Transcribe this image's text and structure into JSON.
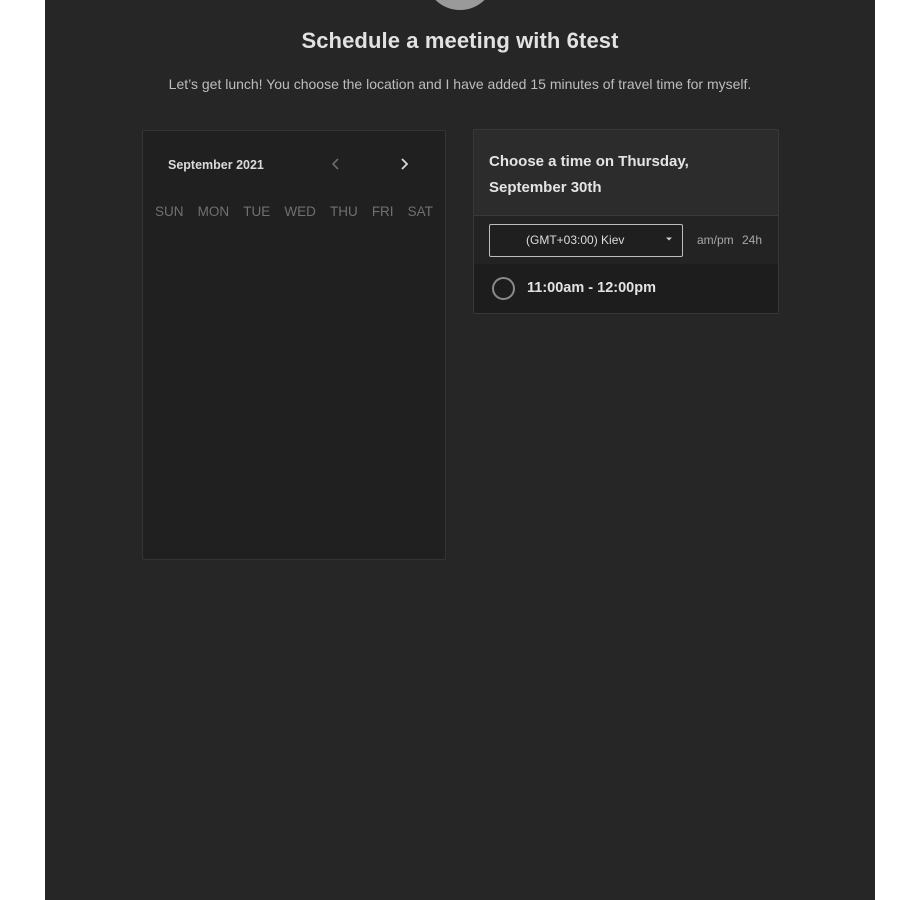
{
  "header": {
    "title": "Schedule a meeting with 6test",
    "subtitle": "Let’s get lunch! You choose the location and I have added 15 minutes of travel time for myself."
  },
  "calendar": {
    "month_label": "September 2021",
    "weekdays": [
      "SUN",
      "MON",
      "TUE",
      "WED",
      "THU",
      "FRI",
      "SAT"
    ],
    "prev_icon": "chevron-left-icon",
    "next_icon": "chevron-right-icon"
  },
  "time_panel": {
    "heading_line1": "Choose a time on Thursday,",
    "heading_line2": "September 30th",
    "timezone": {
      "selected": "(GMT+03:00) Kiev",
      "icon": "caret-down-icon"
    },
    "format_options": [
      "am/pm",
      "24h"
    ],
    "slots": [
      {
        "label": "11:00am - 12:00pm",
        "selected": false
      }
    ]
  },
  "colors": {
    "background": "#262626",
    "panel": "#202020",
    "text": "#e2e2e2",
    "muted": "#707070"
  }
}
